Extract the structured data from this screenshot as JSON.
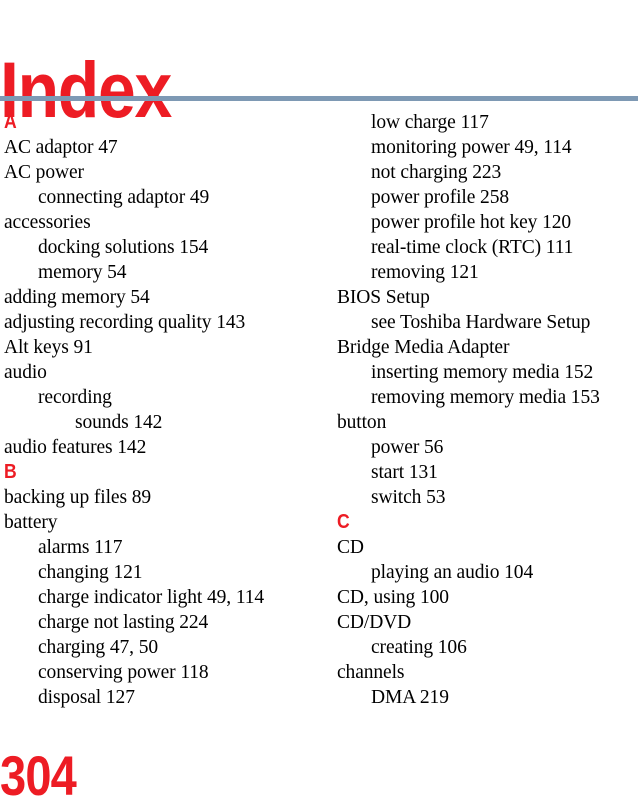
{
  "header": {
    "title": "Index",
    "rule_color": "#7e99b4"
  },
  "colors": {
    "accent_red": "#ed1c24",
    "rule_blue_gray": "#7e99b4",
    "body_text": "#000000"
  },
  "footer": {
    "page_number": "304"
  },
  "columns": {
    "left": [
      {
        "kind": "letter",
        "level": 0,
        "text": "A"
      },
      {
        "kind": "entry",
        "level": 0,
        "text": "AC adaptor 47"
      },
      {
        "kind": "entry",
        "level": 0,
        "text": "AC power"
      },
      {
        "kind": "entry",
        "level": 1,
        "text": "connecting adaptor 49"
      },
      {
        "kind": "entry",
        "level": 0,
        "text": "accessories"
      },
      {
        "kind": "entry",
        "level": 1,
        "text": "docking solutions 154"
      },
      {
        "kind": "entry",
        "level": 1,
        "text": "memory 54"
      },
      {
        "kind": "entry",
        "level": 0,
        "text": "adding memory 54"
      },
      {
        "kind": "entry",
        "level": 0,
        "text": "adjusting recording quality 143"
      },
      {
        "kind": "entry",
        "level": 0,
        "text": "Alt keys 91"
      },
      {
        "kind": "entry",
        "level": 0,
        "text": "audio"
      },
      {
        "kind": "entry",
        "level": 1,
        "text": "recording"
      },
      {
        "kind": "entry",
        "level": 2,
        "text": "sounds 142"
      },
      {
        "kind": "entry",
        "level": 0,
        "text": "audio features 142"
      },
      {
        "kind": "letter",
        "level": 0,
        "text": "B"
      },
      {
        "kind": "entry",
        "level": 0,
        "text": "backing up files 89"
      },
      {
        "kind": "entry",
        "level": 0,
        "text": "battery"
      },
      {
        "kind": "entry",
        "level": 1,
        "text": "alarms 117"
      },
      {
        "kind": "entry",
        "level": 1,
        "text": "changing 121"
      },
      {
        "kind": "entry",
        "level": 1,
        "text": "charge indicator light 49, 114"
      },
      {
        "kind": "entry",
        "level": 1,
        "text": "charge not lasting 224"
      },
      {
        "kind": "entry",
        "level": 1,
        "text": "charging 47, 50"
      },
      {
        "kind": "entry",
        "level": 1,
        "text": "conserving power 118"
      },
      {
        "kind": "entry",
        "level": 1,
        "text": "disposal 127"
      }
    ],
    "right": [
      {
        "kind": "entry",
        "level": 1,
        "text": "low charge 117"
      },
      {
        "kind": "entry",
        "level": 1,
        "text": "monitoring power 49, 114"
      },
      {
        "kind": "entry",
        "level": 1,
        "text": "not charging 223"
      },
      {
        "kind": "entry",
        "level": 1,
        "text": "power profile 258"
      },
      {
        "kind": "entry",
        "level": 1,
        "text": "power profile hot key 120"
      },
      {
        "kind": "entry",
        "level": 1,
        "text": "real-time clock (RTC) 111"
      },
      {
        "kind": "entry",
        "level": 1,
        "text": "removing 121"
      },
      {
        "kind": "entry",
        "level": 0,
        "text": "BIOS Setup"
      },
      {
        "kind": "entry",
        "level": 1,
        "text": "see Toshiba Hardware Setup"
      },
      {
        "kind": "entry",
        "level": 0,
        "text": "Bridge Media Adapter"
      },
      {
        "kind": "entry",
        "level": 1,
        "text": "inserting memory media 152"
      },
      {
        "kind": "entry",
        "level": 1,
        "text": "removing memory media 153"
      },
      {
        "kind": "entry",
        "level": 0,
        "text": "button"
      },
      {
        "kind": "entry",
        "level": 1,
        "text": "power 56"
      },
      {
        "kind": "entry",
        "level": 1,
        "text": "start 131"
      },
      {
        "kind": "entry",
        "level": 1,
        "text": "switch 53"
      },
      {
        "kind": "letter",
        "level": 0,
        "text": "C"
      },
      {
        "kind": "entry",
        "level": 0,
        "text": "CD"
      },
      {
        "kind": "entry",
        "level": 1,
        "text": "playing an audio 104"
      },
      {
        "kind": "entry",
        "level": 0,
        "text": "CD, using 100"
      },
      {
        "kind": "entry",
        "level": 0,
        "text": "CD/DVD"
      },
      {
        "kind": "entry",
        "level": 1,
        "text": "creating 106"
      },
      {
        "kind": "entry",
        "level": 0,
        "text": "channels"
      },
      {
        "kind": "entry",
        "level": 1,
        "text": "DMA 219"
      }
    ]
  }
}
